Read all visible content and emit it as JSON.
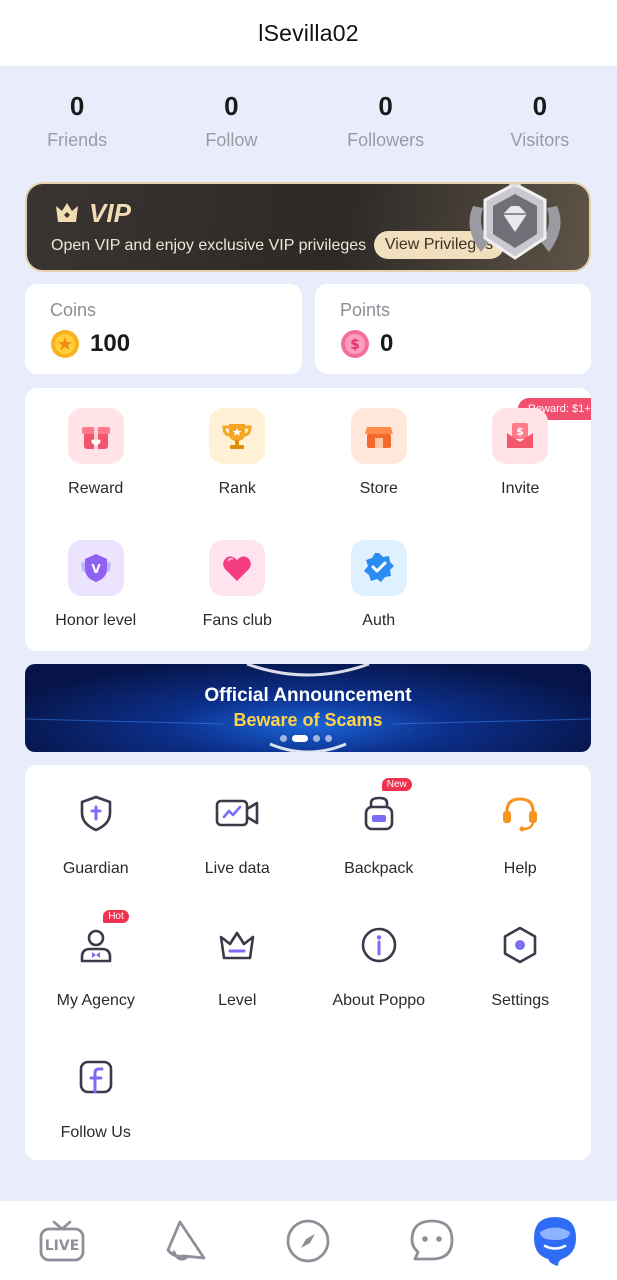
{
  "header": {
    "title": "lSevilla02"
  },
  "stats": [
    {
      "value": "0",
      "label": "Friends"
    },
    {
      "value": "0",
      "label": "Follow"
    },
    {
      "value": "0",
      "label": "Followers"
    },
    {
      "value": "0",
      "label": "Visitors"
    }
  ],
  "vip": {
    "title": "VIP",
    "description": "Open VIP and enjoy exclusive VIP privileges",
    "button": "View Privileges"
  },
  "wallet": {
    "coins": {
      "label": "Coins",
      "value": "100",
      "icon": "coin-icon"
    },
    "points": {
      "label": "Points",
      "value": "0",
      "icon": "points-icon"
    }
  },
  "features": [
    {
      "label": "Reward",
      "icon": "gift-icon"
    },
    {
      "label": "Rank",
      "icon": "trophy-icon"
    },
    {
      "label": "Store",
      "icon": "store-icon"
    },
    {
      "label": "Invite",
      "icon": "invite-envelope-icon",
      "tag": "Reward: $1+"
    },
    {
      "label": "Honor level",
      "icon": "honor-shield-icon"
    },
    {
      "label": "Fans club",
      "icon": "heart-icon"
    },
    {
      "label": "Auth",
      "icon": "verified-badge-icon"
    }
  ],
  "banner": {
    "line1": "Official Announcement",
    "line2": "Beware of Scams"
  },
  "tools": [
    {
      "label": "Guardian",
      "icon": "guardian-shield-icon"
    },
    {
      "label": "Live data",
      "icon": "live-data-icon"
    },
    {
      "label": "Backpack",
      "icon": "backpack-icon",
      "tag": "New"
    },
    {
      "label": "Help",
      "icon": "headset-icon"
    },
    {
      "label": "My Agency",
      "icon": "agency-icon",
      "tag": "Hot"
    },
    {
      "label": "Level",
      "icon": "level-crown-icon"
    },
    {
      "label": "About Poppo",
      "icon": "info-icon"
    },
    {
      "label": "Settings",
      "icon": "settings-hexagon-icon"
    },
    {
      "label": "Follow Us",
      "icon": "facebook-icon"
    }
  ],
  "nav": {
    "live_text": "LIVE",
    "items": [
      "live-tv-icon",
      "megaphone-icon",
      "compass-icon",
      "chat-icon",
      "profile-icon"
    ],
    "active": "profile-icon"
  },
  "colors": {
    "background": "#e9edfb",
    "vip_gold": "#f2dcb4",
    "tag_red": "#f0506e",
    "nav_active": "#2f6cf6",
    "banner_yellow": "#ffd24a"
  }
}
